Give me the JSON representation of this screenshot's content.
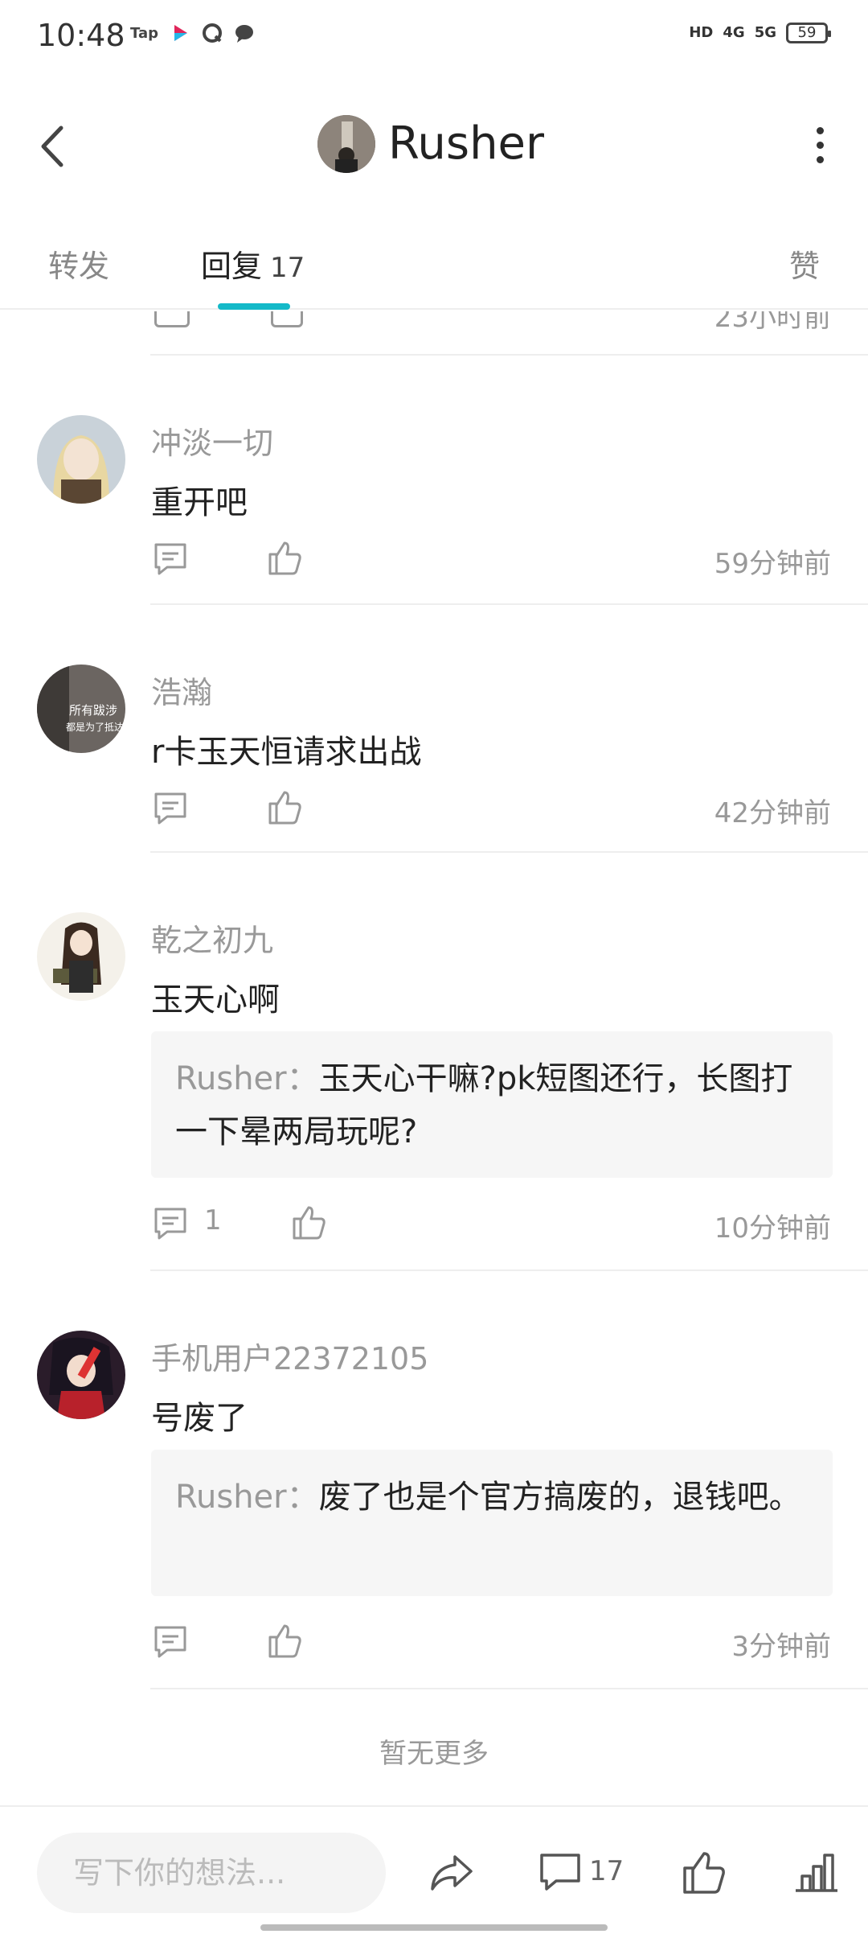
{
  "status_bar": {
    "time": "10:48",
    "app_tap": "Tap",
    "net1": "HD",
    "net2": "4G",
    "net3": "5G",
    "battery": "59"
  },
  "header": {
    "title": "Rusher",
    "back_icon": "chevron-left-icon",
    "more_icon": "more-vertical-icon"
  },
  "tabs": {
    "forward": "转发",
    "reply": "回复",
    "reply_count": "17",
    "like": "赞",
    "active": "reply",
    "accent_color": "#14b9c8"
  },
  "comments": [
    {
      "name": "冲淡一切",
      "text": "重开吧",
      "time": "59分钟前"
    },
    {
      "name": "浩瀚",
      "text": "r卡玉天恒请求出战",
      "time": "42分钟前"
    },
    {
      "name": "乾之初九",
      "text": "玉天心啊",
      "reply_author": "Rusher",
      "reply_sep": "：",
      "reply_text": "玉天心干嘛?pk短图还行，长图打一下晕两局玩呢?",
      "comment_count": "1",
      "time": "10分钟前"
    },
    {
      "name": "手机用户22372105",
      "text": "号废了",
      "reply_author": "Rusher",
      "reply_sep": "：",
      "reply_text": "废了也是个官方搞废的，退钱吧。",
      "time": "3分钟前"
    }
  ],
  "footer": {
    "no_more": "暂无更多"
  },
  "bottom_bar": {
    "placeholder": "写下你的想法...",
    "comment_count": "17"
  }
}
